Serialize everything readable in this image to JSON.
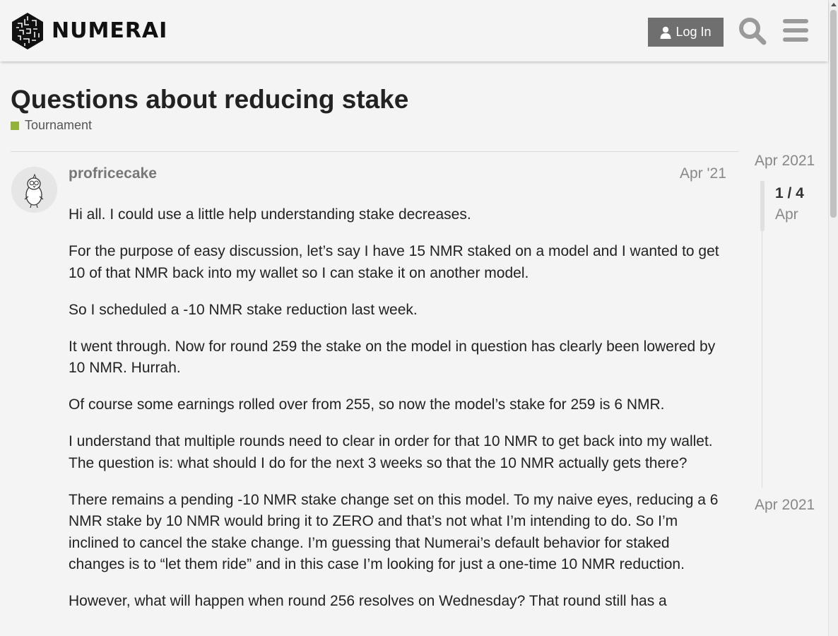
{
  "header": {
    "logo_text": "NUMERAI",
    "login_label": "Log In"
  },
  "topic": {
    "title": "Questions about reducing stake",
    "category": "Tournament",
    "category_color": "#92b33a"
  },
  "post": {
    "username": "profricecake",
    "date": "Apr '21",
    "paragraphs": [
      "Hi all. I could use a little help understanding stake decreases.",
      "For the purpose of easy discussion, let’s say I have 15 NMR staked on a model and I wanted to get 10 of that NMR back into my wallet so I can stake it on another model.",
      "So I scheduled a -10 NMR stake reduction last week.",
      "It went through. Now for round 259 the stake on the model in question has clearly been lowered by 10 NMR. Hurrah.",
      "Of course some earnings rolled over from 255, so now the model’s stake for 259 is 6 NMR.",
      "I understand that multiple rounds need to clear in order for that 10 NMR to get back into my wallet. The question is: what should I do for the next 3 weeks so that the 10 NMR actually gets there?",
      "There remains a pending -10 NMR stake change set on this model. To my naive eyes, reducing a 6 NMR stake by 10 NMR would bring it to ZERO and that’s not what I’m intending to do. So I’m inclined to cancel the stake change. I’m guessing that Numerai’s default behavior for staked changes is to “let them ride” and in this case I’m looking for just a one-time 10 NMR reduction.",
      "However, what will happen when round 256 resolves on Wednesday? That round still has a"
    ]
  },
  "timeline": {
    "start_label": "Apr 2021",
    "position": "1 / 4",
    "position_date": "Apr",
    "end_label": "Apr 2021"
  }
}
